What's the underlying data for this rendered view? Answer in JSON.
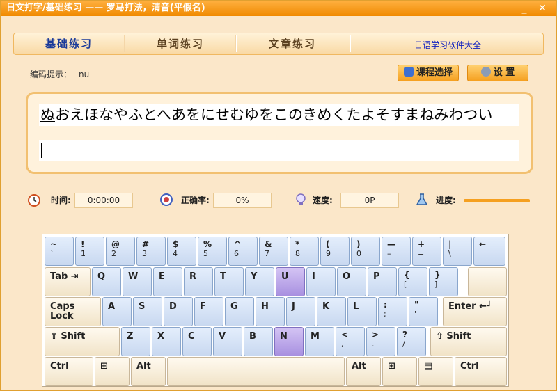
{
  "window": {
    "title": "日文打字/基础练习 —— 罗马打法，清音(平假名)",
    "minimize": "_",
    "close": "✕"
  },
  "tabs": [
    {
      "label": "基础练习"
    },
    {
      "label": "单词练习"
    },
    {
      "label": "文章练习"
    }
  ],
  "link": "日语学习软件大全",
  "hint": {
    "label": "编码提示：",
    "value": "nu"
  },
  "buttons": {
    "course": "课程选择",
    "settings": "设 置"
  },
  "practice": {
    "current_char": "ぬ",
    "rest_text": "おえほなやふとへあをにせむゆをこのきめくたよそすまねみわつい",
    "input": ""
  },
  "stats": {
    "time_label": "时间:",
    "time_value": "0:00:00",
    "accuracy_label": "正确率:",
    "accuracy_value": "0%",
    "speed_label": "速度:",
    "speed_value": "0P",
    "progress_label": "进度:",
    "progress_value": 0
  },
  "keyboard": {
    "row1": [
      {
        "t": "~",
        "b": "`"
      },
      {
        "t": "!",
        "b": "1"
      },
      {
        "t": "@",
        "b": "2"
      },
      {
        "t": "#",
        "b": "3"
      },
      {
        "t": "$",
        "b": "4"
      },
      {
        "t": "%",
        "b": "5"
      },
      {
        "t": "^",
        "b": "6"
      },
      {
        "t": "&",
        "b": "7"
      },
      {
        "t": "*",
        "b": "8"
      },
      {
        "t": "(",
        "b": "9"
      },
      {
        "t": ")",
        "b": "0"
      },
      {
        "t": "—",
        "b": "–"
      },
      {
        "t": "+",
        "b": "="
      },
      {
        "t": "|",
        "b": "\\"
      },
      {
        "t": "←",
        "b": ""
      }
    ],
    "tab": "Tab",
    "row2": [
      "Q",
      "W",
      "E",
      "R",
      "T",
      "Y",
      "U",
      "I",
      "O",
      "P"
    ],
    "row2_sym": [
      {
        "t": "{",
        "b": "["
      },
      {
        "t": "}",
        "b": "]"
      }
    ],
    "caps": "Caps Lock",
    "row3": [
      "A",
      "S",
      "D",
      "F",
      "G",
      "H",
      "J",
      "K",
      "L"
    ],
    "row3_sym": [
      {
        "t": ":",
        "b": ";"
      },
      {
        "t": "\"",
        "b": "'"
      }
    ],
    "enter": "Enter",
    "shift_left": "⇧ Shift",
    "row4": [
      "Z",
      "X",
      "C",
      "V",
      "B",
      "N",
      "M"
    ],
    "row4_sym": [
      {
        "t": "<",
        "b": ","
      },
      {
        "t": ">",
        "b": "."
      },
      {
        "t": "?",
        "b": "/"
      }
    ],
    "shift_right": "⇧ Shift",
    "ctrl": "Ctrl",
    "alt": "Alt",
    "highlighted": [
      "U",
      "N"
    ]
  },
  "colors": {
    "accent": "#f08a00",
    "highlight": "#a890e0",
    "key": "#d0def2"
  }
}
